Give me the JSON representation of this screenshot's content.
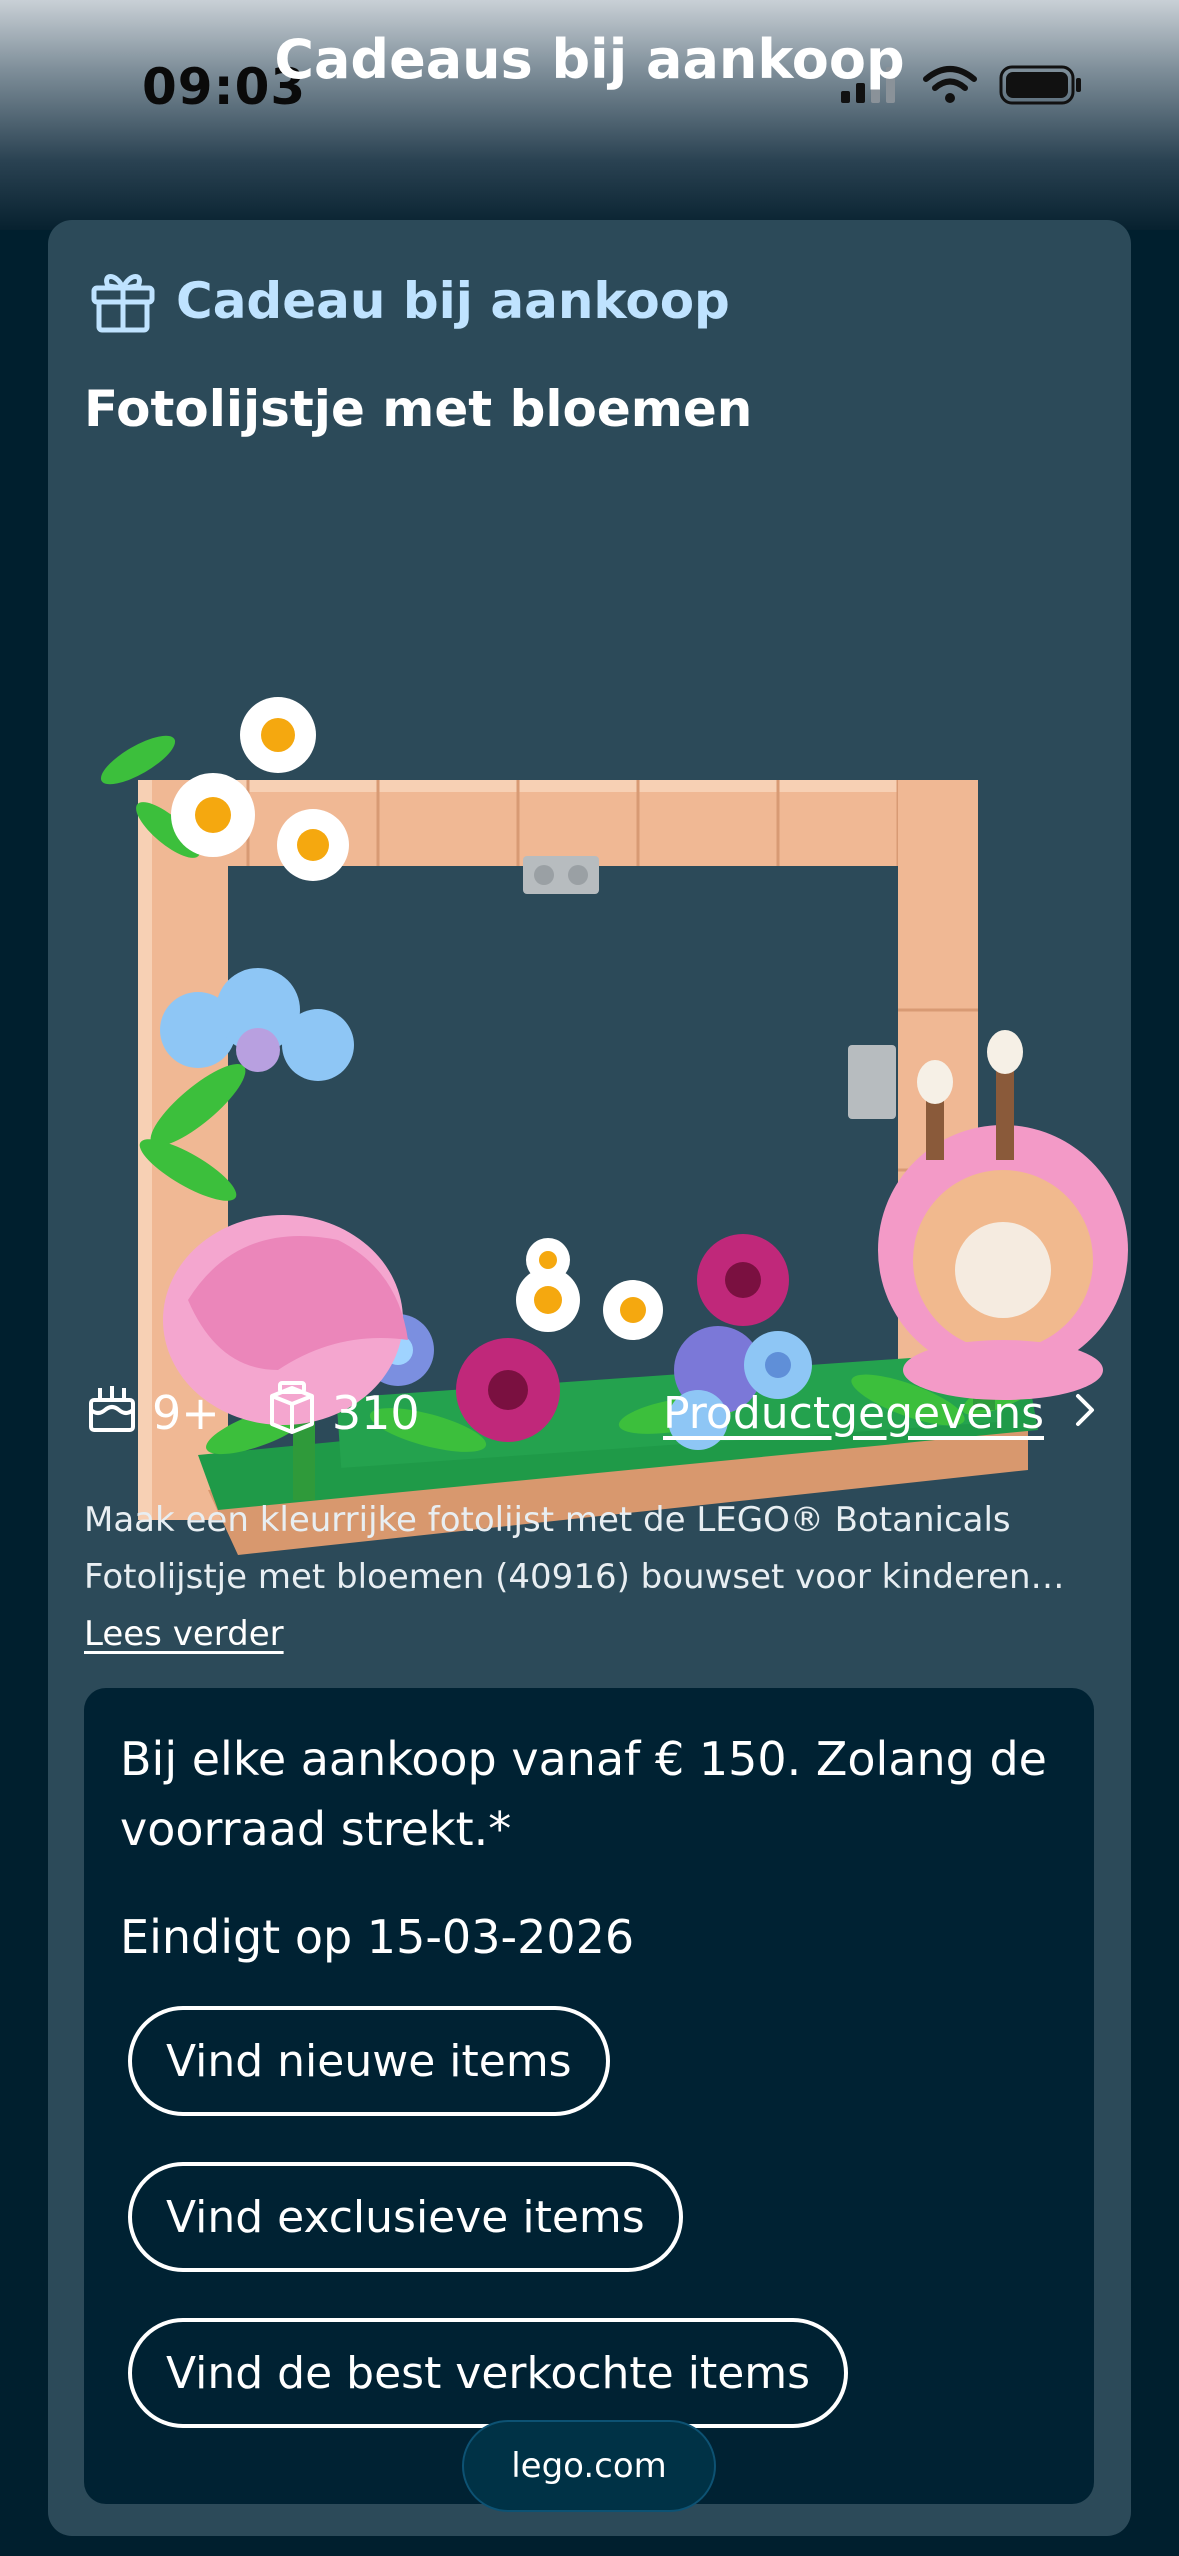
{
  "status_bar": {
    "time": "09:03",
    "icons": [
      "cellular-signal-icon",
      "wifi-icon",
      "battery-icon"
    ]
  },
  "header": {
    "title": "Cadeaus bij aankoop"
  },
  "card": {
    "gift_label": "Cadeau bij aankoop",
    "gift_icon": "gift-icon",
    "product_title": "Fotolijstje met bloemen",
    "specs": {
      "age": "9+",
      "age_icon": "birthday-cake-icon",
      "pieces": "310",
      "pieces_icon": "brick-icon"
    },
    "details_link": "Productgegevens",
    "description": "Maak een kleurrijke fotolijst met de LEGO® Botanicals Fotolijstje met bloemen (40916) bouwset voor kinderen…",
    "read_more": "Lees verder"
  },
  "promo": {
    "text": "Bij elke aankoop vanaf € 150. Zolang de voorraad strekt.*",
    "end_date": "Eindigt op 15-03-2026",
    "buttons": {
      "new": "Vind nieuwe items",
      "exclusive": "Vind exclusieve items",
      "best": "Vind de best verkochte items"
    }
  },
  "browser": {
    "url": "lego.com"
  },
  "colors": {
    "background": "#001f2e",
    "card": "#2c4a59",
    "promo_box": "#002233",
    "gift_label": "#bfe3ff"
  }
}
